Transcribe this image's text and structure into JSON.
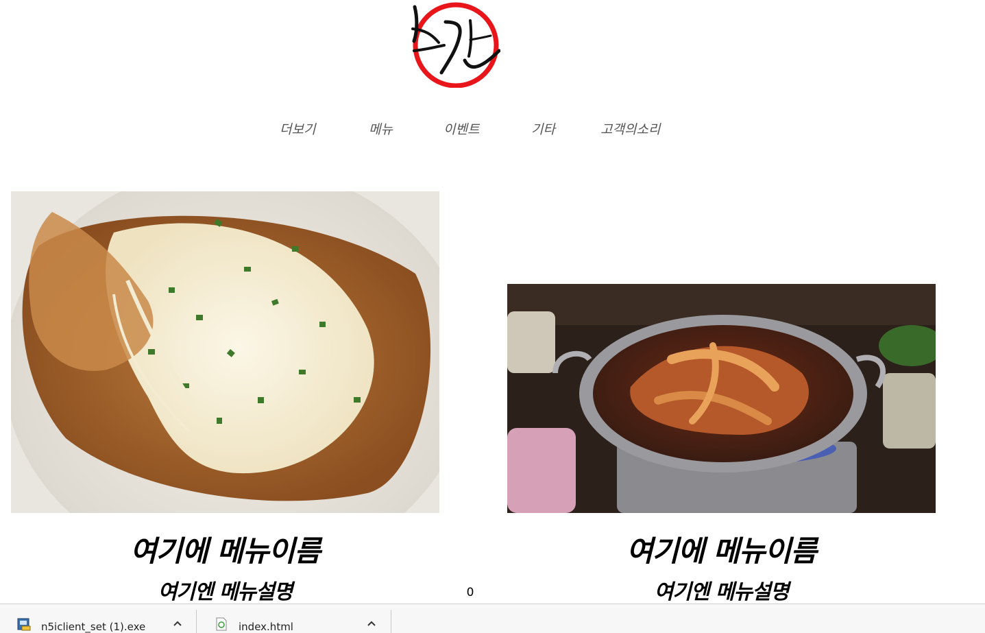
{
  "nav": {
    "items": [
      "더보기",
      "메뉴",
      "이벤트",
      "기타",
      "고객의소리"
    ]
  },
  "menus": [
    {
      "name": "여기에 메뉴이름",
      "desc": "여기엔 메뉴설명"
    },
    {
      "name": "여기에 메뉴이름",
      "desc": "여기엔 메뉴설명"
    }
  ],
  "counter": "0",
  "downloads": [
    {
      "file": "n5iclient_set (1).exe"
    },
    {
      "file": "index.html"
    }
  ],
  "colors": {
    "logo_ring": "#e8151b",
    "nav_text": "#555555"
  }
}
